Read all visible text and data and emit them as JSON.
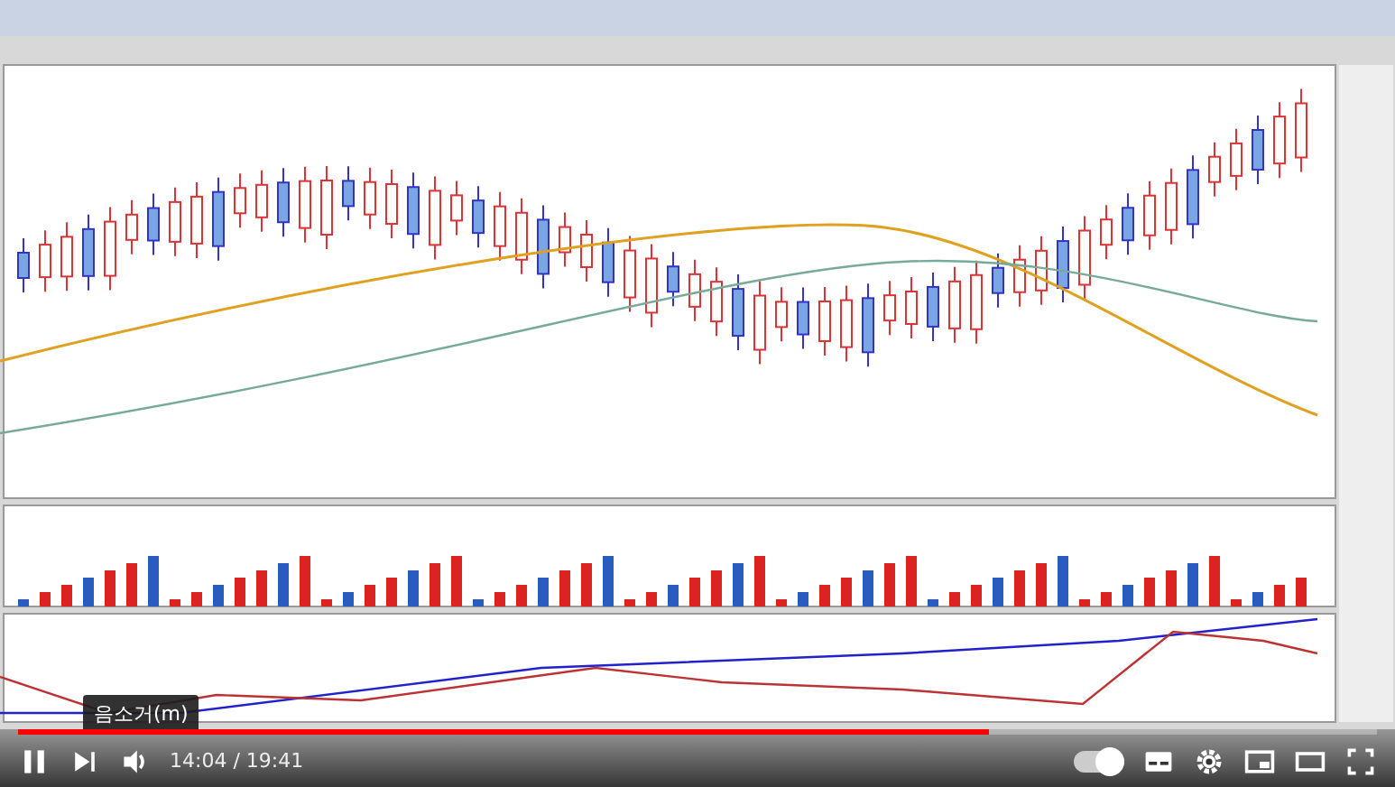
{
  "player": {
    "tooltip": "음소거(m)",
    "progress": {
      "level": 0.715
    },
    "time": "14:04 / 19:41",
    "autoplay": {
      "on": true
    }
  }
}
